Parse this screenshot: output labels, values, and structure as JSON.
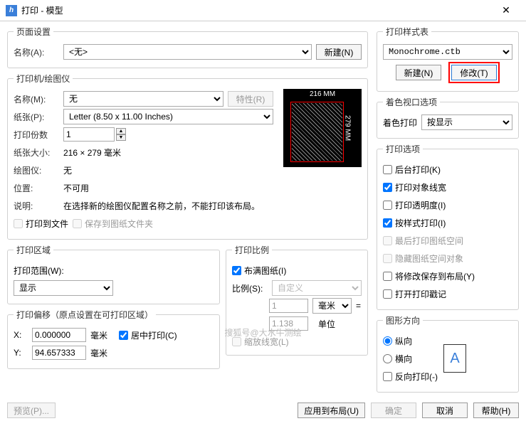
{
  "title": "打印 - 模型",
  "close": "✕",
  "page_setup": {
    "legend": "页面设置",
    "name_lab": "名称(A):",
    "name_sel": "<无>",
    "new_btn": "新建(N)"
  },
  "plotter": {
    "legend": "打印机/绘图仪",
    "name_lab": "名称(M):",
    "name_sel": "无",
    "prop_btn": "特性(R)",
    "paper_lab": "纸张(P):",
    "paper_sel": "Letter (8.50 x 11.00 Inches)",
    "copies_lab": "打印份数",
    "copies_val": "1",
    "papersize_lab": "纸张大小:",
    "papersize_val": "216 × 279  毫米",
    "device_lab": "绘图仪:",
    "device_val": "无",
    "loc_lab": "位置:",
    "loc_val": "不可用",
    "desc_lab": "说明:",
    "desc_val": "在选择新的绘图仪配置名称之前，不能打印该布局。",
    "tofile_lab": "打印到文件",
    "savefolder_lab": "保存到图纸文件夹",
    "pv_top": "216 MM",
    "pv_side": "279 MM"
  },
  "area": {
    "legend": "打印区域",
    "what_lab": "打印范围(W):",
    "what_sel": "显示"
  },
  "scale": {
    "legend": "打印比例",
    "fit_lab": "布满图纸(I)",
    "scale_lab": "比例(S):",
    "scale_sel": "自定义",
    "num_val": "1",
    "unit_sel": "毫米",
    "eq": "=",
    "den_val": "1.138",
    "unit_lab": "单位",
    "lw_lab": "缩放线宽(L)"
  },
  "offset": {
    "legend": "打印偏移（原点设置在可打印区域）",
    "x_lab": "X:",
    "x_val": "0.000000",
    "x_unit": "毫米",
    "y_lab": "Y:",
    "y_val": "94.657333",
    "y_unit": "毫米",
    "center_lab": "居中打印(C)"
  },
  "style": {
    "legend": "打印样式表",
    "sel": "Monochrome.ctb",
    "new_btn": "新建(N)",
    "edit_btn": "修改(T)"
  },
  "viewport": {
    "legend": "着色视口选项",
    "shade_lab": "着色打印",
    "shade_sel": "按显示"
  },
  "options": {
    "legend": "打印选项",
    "bg": "后台打印(K)",
    "lw": "打印对象线宽",
    "tr": "打印透明度(I)",
    "ps": "按样式打印(I)",
    "last": "最后打印图纸空间",
    "hide": "隐藏图纸空间对象",
    "save": "将修改保存到布局(Y)",
    "stamp": "打开打印戳记"
  },
  "orient": {
    "legend": "图形方向",
    "portrait": "纵向",
    "landscape": "横向",
    "upside": "反向打印(-)",
    "glyph": "A"
  },
  "footer": {
    "preview": "预览(P)...",
    "apply": "应用到布局(U)",
    "ok": "确定",
    "cancel": "取消",
    "help": "帮助(H)"
  },
  "watermark": "搜狐号@大水牛测绘"
}
